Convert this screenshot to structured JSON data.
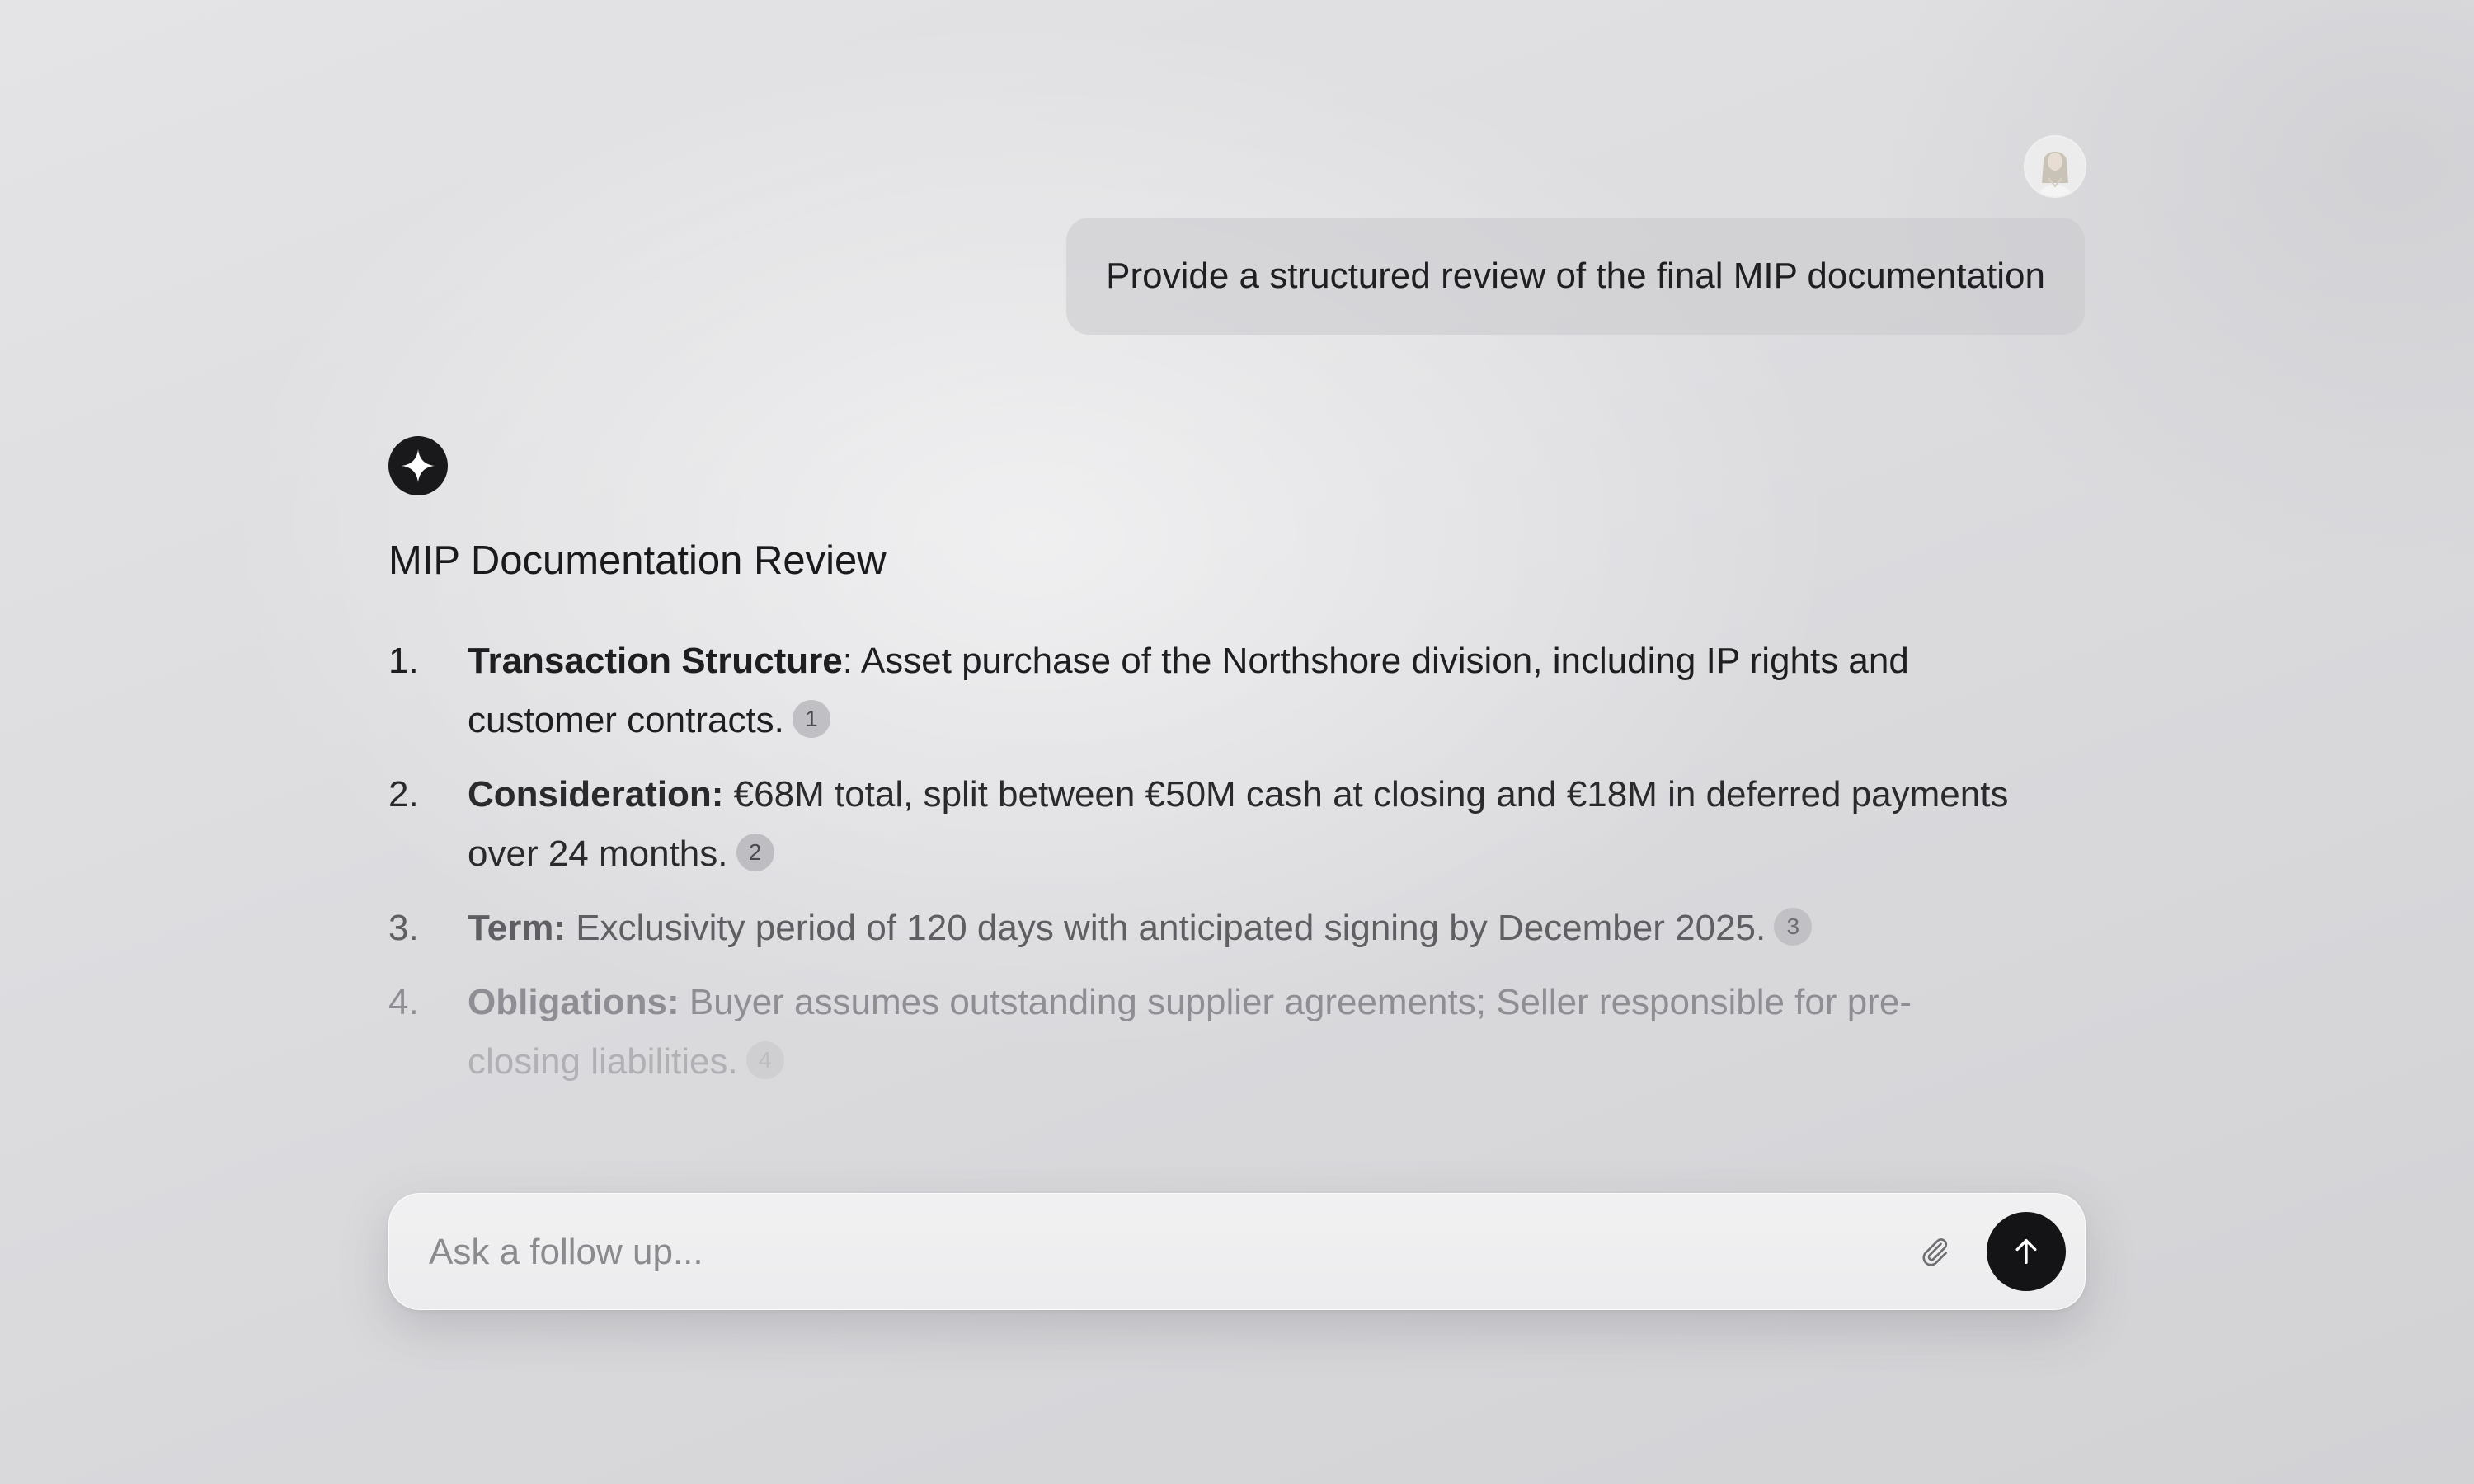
{
  "user_message": {
    "text": "Provide a structured review of the final MIP documentation",
    "avatar_icon": "user-avatar-photo"
  },
  "assistant": {
    "icon": "sparkle-icon",
    "title": "MIP Documentation Review",
    "items": [
      {
        "number": "1.",
        "term": "Transaction Structure",
        "separator": ":",
        "text": " Asset purchase of the Northshore division, including IP rights and customer contracts.",
        "citation": "1"
      },
      {
        "number": "2.",
        "term": "Consideration:",
        "separator": "",
        "text": " €68M total, split between €50M cash at closing and €18M in deferred payments over 24 months.",
        "citation": "2"
      },
      {
        "number": "3.",
        "term": "Term:",
        "separator": "",
        "text": " Exclusivity period of 120 days with anticipated signing by December 2025.",
        "citation": "3"
      },
      {
        "number": "4.",
        "term": "Obligations:",
        "separator": "",
        "text": " Buyer assumes outstanding supplier agreements; Seller responsible for pre-",
        "text_line2": "closing liabilities.",
        "citation": "4"
      }
    ]
  },
  "composer": {
    "placeholder": "Ask a follow up...",
    "value": "",
    "attach_icon": "paperclip-icon",
    "send_icon": "arrow-up-icon"
  },
  "colors": {
    "accent_dark": "#141416",
    "bubble": "#cbcbcf",
    "background": "#dcdcdf"
  }
}
